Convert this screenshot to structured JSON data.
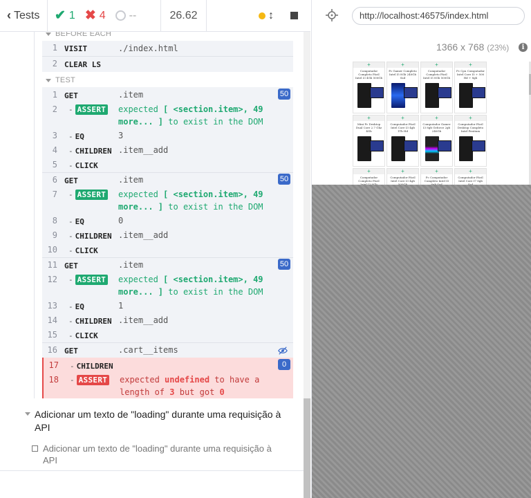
{
  "topbar": {
    "tests_label": "Tests",
    "passed": "1",
    "failed": "4",
    "pending": "--",
    "duration": "26.62"
  },
  "before_each": {
    "header": "BEFORE EACH",
    "commands": [
      {
        "n": "1",
        "name": "VISIT",
        "msg": "./index.html"
      },
      {
        "n": "2",
        "name": "CLEAR LS",
        "msg": ""
      }
    ]
  },
  "test": {
    "header": "TEST",
    "commands": [
      {
        "n": "1",
        "name": "GET",
        "msg": ".item",
        "count": "50"
      },
      {
        "n": "2",
        "name": "ASSERT",
        "msg_parts": [
          "expected",
          "[ <section.item>, 49 more... ]",
          "to exist in the DOM"
        ]
      },
      {
        "n": "3",
        "name": "EQ",
        "msg": "3"
      },
      {
        "n": "4",
        "name": "CHILDREN",
        "msg": ".item__add"
      },
      {
        "n": "5",
        "name": "CLICK",
        "msg": ""
      },
      {
        "n": "6",
        "name": "GET",
        "msg": ".item",
        "count": "50"
      },
      {
        "n": "7",
        "name": "ASSERT",
        "msg_parts": [
          "expected",
          "[ <section.item>, 49 more... ]",
          "to exist in the DOM"
        ]
      },
      {
        "n": "8",
        "name": "EQ",
        "msg": "0"
      },
      {
        "n": "9",
        "name": "CHILDREN",
        "msg": ".item__add"
      },
      {
        "n": "10",
        "name": "CLICK",
        "msg": ""
      },
      {
        "n": "11",
        "name": "GET",
        "msg": ".item",
        "count": "50"
      },
      {
        "n": "12",
        "name": "ASSERT",
        "msg_parts": [
          "expected",
          "[ <section.item>, 49 more... ]",
          "to exist in the DOM"
        ]
      },
      {
        "n": "13",
        "name": "EQ",
        "msg": "1"
      },
      {
        "n": "14",
        "name": "CHILDREN",
        "msg": ".item__add"
      },
      {
        "n": "15",
        "name": "CLICK",
        "msg": ""
      },
      {
        "n": "16",
        "name": "GET",
        "msg": ".cart__items"
      },
      {
        "n": "17",
        "name": "CHILDREN",
        "msg": "",
        "count": "0"
      },
      {
        "n": "18",
        "name": "ASSERT",
        "msg_parts": [
          "expected",
          "undefined",
          "to have a length of",
          "3",
          "but got",
          "0"
        ]
      }
    ]
  },
  "suite": {
    "title": "Adicionar um texto de \"loading\" durante uma requisição à API",
    "test_title": "Adicionar um texto de \"loading\" durante uma requisição à API"
  },
  "aut": {
    "url": "http://localhost:46575/index.html",
    "viewport": "1366 x 768",
    "scale": "(23%)",
    "info": "i",
    "products": [
      "Computador Completo Fácil Intel I3 4Gb 500Gb",
      "Pc Gamer Completo Intel I5 8Gb 240Gb Ssd",
      "Computador Completo Fácil Intel I5 8Gb 500Gb",
      "Pc Cpu Computador Intel Core I5 + 500 Hd + 8gb",
      "Mini Pc Desktop Dual Core 2.7 Ghz 4Gb",
      "Computador Fácil Intel Core I3 4gb 1Tb Hd",
      "Computador Gamer I3 8gb Geforce 2gb 240Gb",
      "Computador Fácil Desktop Completo Intel Pentium",
      "Computador Completo Fácil Intel I3 8Gb",
      "Computador Fácil Intel Core I3 4gb 500Gb",
      "Pc Computador Completo Intel I5 8gb Ssd",
      "Computador Fácil Intel Core I7 8gb Ssd"
    ]
  }
}
